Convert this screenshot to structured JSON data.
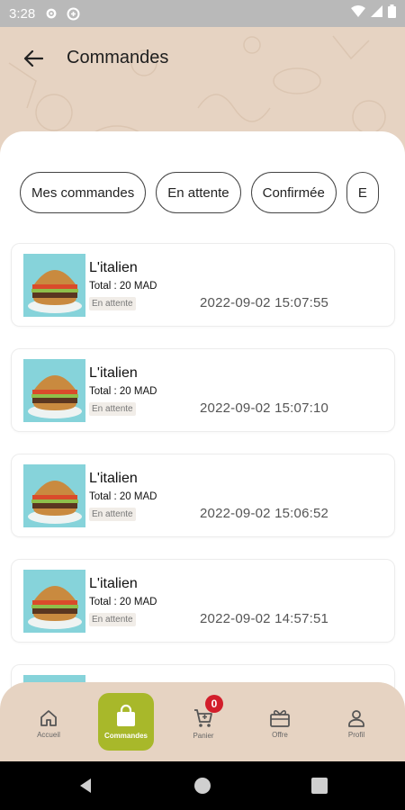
{
  "status_bar": {
    "time": "3:28"
  },
  "header": {
    "title": "Commandes"
  },
  "filters": [
    "Mes commandes",
    "En attente",
    "Confirmée",
    "E"
  ],
  "orders": [
    {
      "name": "L'italien",
      "total": "Total : 20 MAD",
      "status": "En attente",
      "date": "2022-09-02 15:07:55"
    },
    {
      "name": "L'italien",
      "total": "Total : 20 MAD",
      "status": "En attente",
      "date": "2022-09-02 15:07:10"
    },
    {
      "name": "L'italien",
      "total": "Total : 20 MAD",
      "status": "En attente",
      "date": "2022-09-02 15:06:52"
    },
    {
      "name": "L'italien",
      "total": "Total : 20 MAD",
      "status": "En attente",
      "date": "2022-09-02 14:57:51"
    },
    {
      "name": "",
      "total": "",
      "status": "",
      "date": ""
    }
  ],
  "bottom_nav": {
    "items": [
      {
        "label": "Accueil",
        "icon": "home-icon"
      },
      {
        "label": "Commandes",
        "icon": "shopping-bag-icon",
        "active": true
      },
      {
        "label": "Panier",
        "icon": "cart-icon",
        "badge": "0"
      },
      {
        "label": "Offre",
        "icon": "gift-icon"
      },
      {
        "label": "Profil",
        "icon": "user-icon"
      }
    ]
  },
  "colors": {
    "accent": "#a8b82a",
    "header_bg": "#e6d3c2",
    "badge": "#d21e2b"
  }
}
